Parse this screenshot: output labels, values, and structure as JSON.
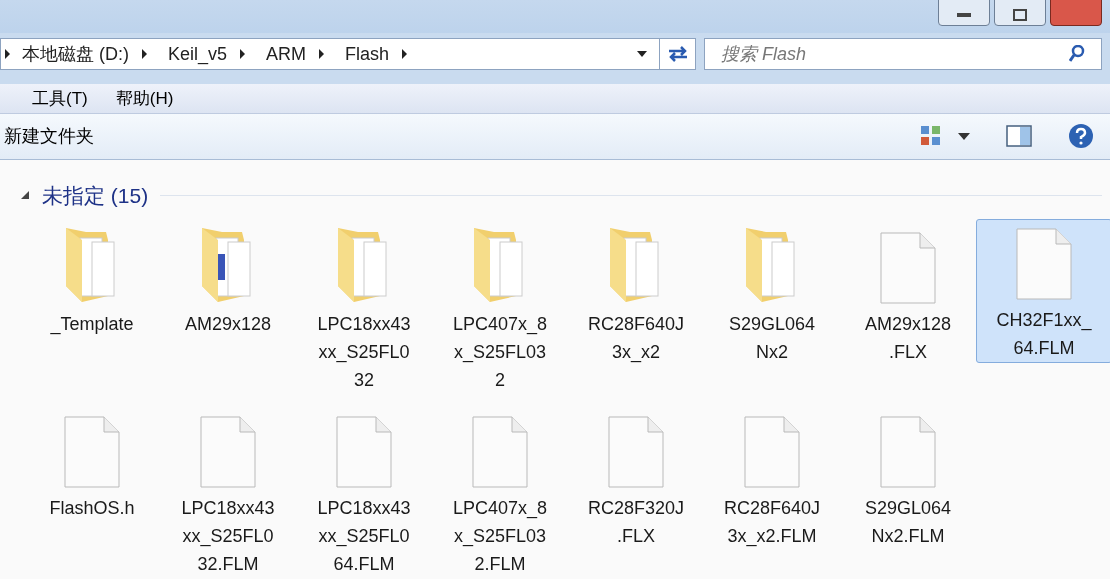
{
  "breadcrumb": [
    "本地磁盘 (D:)",
    "Keil_v5",
    "ARM",
    "Flash"
  ],
  "search": {
    "placeholder": "搜索 Flash"
  },
  "menu": [
    "工具(T)",
    "帮助(H)"
  ],
  "toolbar": {
    "new_folder": "新建文件夹"
  },
  "group": {
    "title": "未指定 (15)",
    "expanded": true
  },
  "items": [
    {
      "kind": "folder",
      "lines": [
        "_Template"
      ],
      "selected": false
    },
    {
      "kind": "folder-doc",
      "lines": [
        "AM29x128"
      ],
      "selected": false
    },
    {
      "kind": "folder",
      "lines": [
        "LPC18xx43",
        "xx_S25FL0",
        "32"
      ],
      "selected": false
    },
    {
      "kind": "folder",
      "lines": [
        "LPC407x_8",
        "x_S25FL03",
        "2"
      ],
      "selected": false
    },
    {
      "kind": "folder",
      "lines": [
        "RC28F640J",
        "3x_x2"
      ],
      "selected": false
    },
    {
      "kind": "folder",
      "lines": [
        "S29GL064",
        "Nx2"
      ],
      "selected": false
    },
    {
      "kind": "file",
      "lines": [
        "AM29x128",
        ".FLX"
      ],
      "selected": false
    },
    {
      "kind": "file",
      "lines": [
        "CH32F1xx_",
        "64.FLM"
      ],
      "selected": true
    },
    {
      "kind": "file",
      "lines": [
        "FlashOS.h"
      ],
      "selected": false
    },
    {
      "kind": "file",
      "lines": [
        "LPC18xx43",
        "xx_S25FL0",
        "32.FLM"
      ],
      "selected": false
    },
    {
      "kind": "file",
      "lines": [
        "LPC18xx43",
        "xx_S25FL0",
        "64.FLM"
      ],
      "selected": false
    },
    {
      "kind": "file",
      "lines": [
        "LPC407x_8",
        "x_S25FL03",
        "2.FLM"
      ],
      "selected": false
    },
    {
      "kind": "file",
      "lines": [
        "RC28F320J",
        ".FLX"
      ],
      "selected": false
    },
    {
      "kind": "file",
      "lines": [
        "RC28F640J",
        "3x_x2.FLM"
      ],
      "selected": false
    },
    {
      "kind": "file",
      "lines": [
        "S29GL064",
        "Nx2.FLM"
      ],
      "selected": false
    }
  ]
}
